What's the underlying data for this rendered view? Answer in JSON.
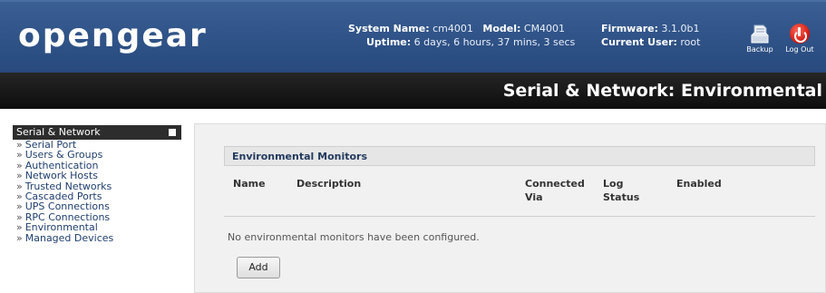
{
  "header": {
    "logo": "opengear",
    "system_name_label": "System Name:",
    "system_name": "cm4001",
    "model_label": "Model:",
    "model": "CM4001",
    "firmware_label": "Firmware:",
    "firmware": "3.1.0b1",
    "uptime_label": "Uptime:",
    "uptime": "6 days, 6 hours, 37 mins, 3 secs",
    "current_user_label": "Current User:",
    "current_user": "root",
    "backup_label": "Backup",
    "logout_label": "Log Out"
  },
  "title_bar": {
    "title": "Serial & Network: Environmental"
  },
  "sidebar": {
    "heading": "Serial & Network",
    "items": [
      {
        "label": "Serial Port"
      },
      {
        "label": "Users & Groups"
      },
      {
        "label": "Authentication"
      },
      {
        "label": "Network Hosts"
      },
      {
        "label": "Trusted Networks"
      },
      {
        "label": "Cascaded Ports"
      },
      {
        "label": "UPS Connections"
      },
      {
        "label": "RPC Connections"
      },
      {
        "label": "Environmental"
      },
      {
        "label": "Managed Devices"
      }
    ]
  },
  "main": {
    "section_title": "Environmental Monitors",
    "columns": {
      "name": "Name",
      "description": "Description",
      "connected_via_1": "Connected",
      "connected_via_2": "Via",
      "log_status_1": "Log",
      "log_status_2": "Status",
      "enabled": "Enabled"
    },
    "empty_message": "No environmental monitors have been configured.",
    "add_button": "Add"
  },
  "colors": {
    "header_blue": "#2c4f84",
    "title_bar": "#111111",
    "accent_red": "#d0120b"
  },
  "icons": {
    "backup": "backup-icon",
    "logout": "power-icon"
  }
}
